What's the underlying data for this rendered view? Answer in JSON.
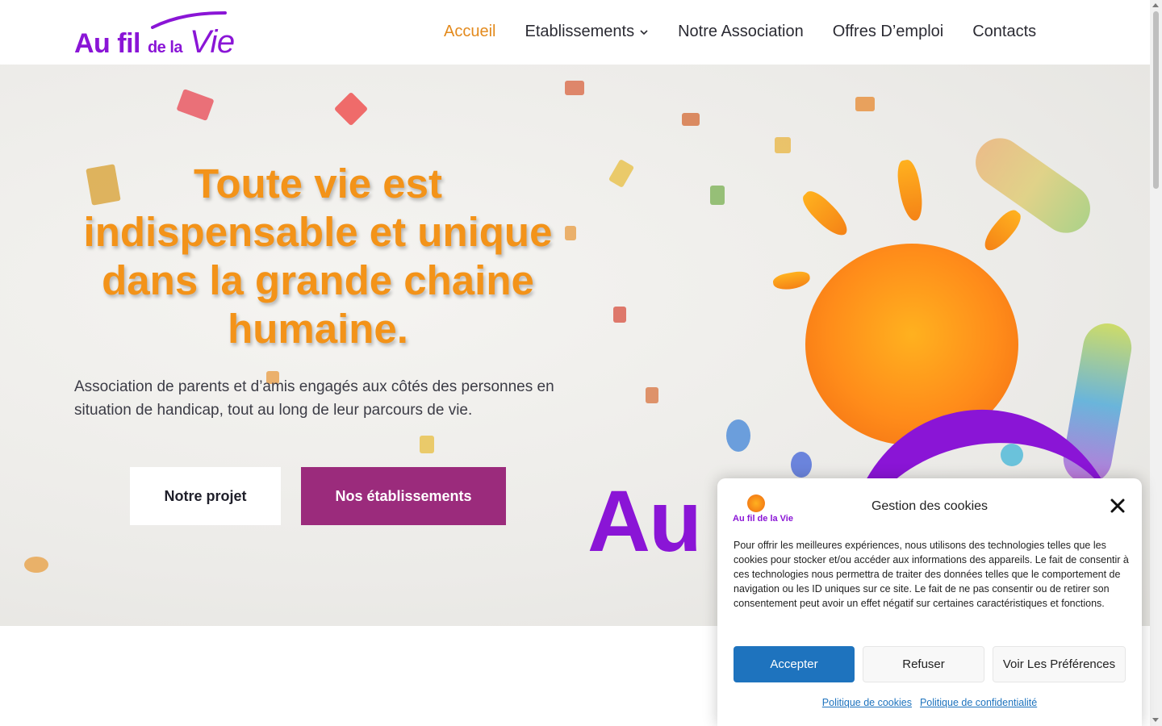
{
  "header": {
    "logo": {
      "au": "Au",
      "fil": "fil",
      "dela": "de la",
      "vie": "Vie"
    },
    "nav": [
      {
        "label": "Accueil",
        "active": true
      },
      {
        "label": "Etablissements",
        "has_dropdown": true
      },
      {
        "label": "Notre Association"
      },
      {
        "label": "Offres D’emploi"
      },
      {
        "label": "Contacts"
      }
    ]
  },
  "hero": {
    "title": "Toute vie est indispensable et unique dans la grande chaine humaine.",
    "subtitle": "Association de parents et d’amis engagés aux côtés des personnes en situation de handicap, tout au long de leur parcours de vie.",
    "buttons": {
      "primary": "Notre projet",
      "secondary": "Nos établissements"
    },
    "logo_letters": "Au"
  },
  "cookie_banner": {
    "title": "Gestion des cookies",
    "logo_text": "Au fil de la Vie",
    "body": "Pour offrir les meilleures expériences, nous utilisons des technologies telles que les cookies pour stocker et/ou accéder aux informations des appareils. Le fait de consentir à ces technologies nous permettra de traiter des données telles que le comportement de navigation ou les ID uniques sur ce site. Le fait de ne pas consentir ou de retirer son consentement peut avoir un effet négatif sur certaines caractéristiques et fonctions.",
    "accept": "Accepter",
    "refuse": "Refuser",
    "preferences": "Voir Les Préférences",
    "links": {
      "cookies": "Politique de cookies",
      "privacy": "Politique de confidentialité"
    }
  },
  "colors": {
    "brand_purple": "#8a15d6",
    "accent_orange": "#f39319",
    "button_purple": "#9b2b7c",
    "cookie_blue": "#1e73be"
  }
}
